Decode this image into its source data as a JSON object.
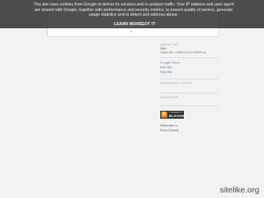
{
  "cookie_banner": {
    "message": "This site uses cookies from Google to deliver its services and to analyze traffic. Your IP address and user-agent are shared with Google, together with performance and security metrics, to ensure quality of service, generate usage statistics and to detect and address abuse.",
    "learn_more": "LEARN MORE",
    "got_it": "GOT IT"
  },
  "content": {
    "nav_arrow": "»"
  },
  "sidebar": {
    "about_title": "ABOUT ME",
    "about_name": "fitfit",
    "profile_link": "VIEW MY COMPLETE PROFILE",
    "links": [
      "Google News",
      "Edit-Me",
      "Edit-Me"
    ],
    "previous_posts_title": "PREVIOUS POSTS",
    "archives_title": "ARCHIVES",
    "badge": {
      "top": "POWERED BY",
      "name": "BLOGGER"
    },
    "subscribe_text": "Subscribe to",
    "subscribe_link": "Posts [Atom]"
  },
  "footer": {
    "logo_text": "sitelike.org"
  },
  "colors": {
    "banner": "#282828",
    "badge_icon": "#f57d00",
    "link": "#5a7fa8"
  }
}
